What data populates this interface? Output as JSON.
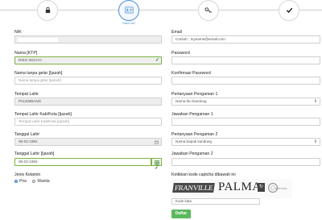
{
  "stepper": {
    "caption": "Data Diri",
    "steps": [
      {
        "icon": "lock-icon"
      },
      {
        "icon": "id-card-icon"
      },
      {
        "icon": "key-icon"
      },
      {
        "icon": "check-icon"
      }
    ]
  },
  "left": {
    "nik_label": "NIK",
    "nama_ktp_label": "Nama [KTP]",
    "nama_ktp_value": "RIKO WIJAYA",
    "nama_gelar_label": "Nama tanpa gelar [Ijazah]",
    "nama_gelar_placeholder": "Nama tanpa gelar [Ijazah]",
    "tempat_lahir_label": "Tempat Lahir",
    "tempat_lahir_value": "PALEMBANG",
    "tempat_lahir_ijazah_label": "Tempat Lahir Kab/Kota [Ijazah]",
    "tempat_lahir_ijazah_placeholder": "Tempat Lahir Kab/Kota [Ijazah]",
    "tanggal_lahir_label": "Tanggal Lahir",
    "tanggal_lahir_value": "06-02-1992",
    "tanggal_lahir_ijazah_label": "Tanggal Lahir [Ijazah]",
    "tanggal_lahir_ijazah_value": "06-02-1992",
    "jenis_kelamin_label": "Jenis Kelamin",
    "gender_options": [
      "Pria",
      "Wanita"
    ],
    "gender_selected": "Pria"
  },
  "right": {
    "email_label": "Email",
    "email_placeholder": "Contoh : myname@email.com",
    "password_label": "Password",
    "konfirmasi_label": "Konfirmasi Password",
    "pertanyaan1_label": "Pertanyaan Pengaman 1",
    "pertanyaan1_value": "Nama ibu kandung",
    "jawaban1_label": "Jawaban Pengaman 1",
    "pertanyaan2_label": "Pertanyaan Pengaman 2",
    "pertanyaan2_value": "Nama bapak kandung",
    "jawaban2_label": "Jawaban Pengaman 2",
    "captcha_label": "Ketikkan kode captcha dibawah ini",
    "captcha_word1": "FRANVILLE",
    "captcha_word2": "PALMA",
    "captcha_brand": "CAPTCHA",
    "captcha_input_value": "Kode kata",
    "submit_label": "Daftar"
  },
  "colors": {
    "accent": "#4a90d6",
    "valid": "#7cb342",
    "submit": "#5cb85c"
  }
}
